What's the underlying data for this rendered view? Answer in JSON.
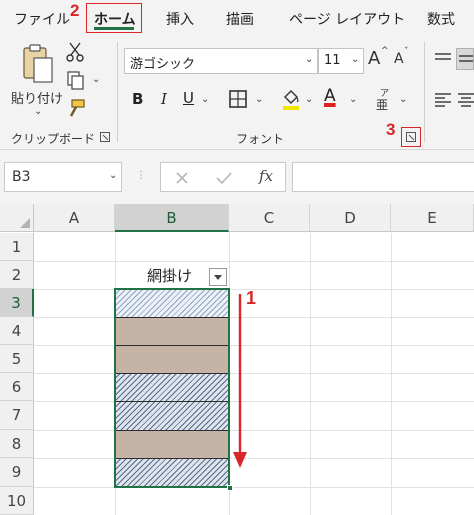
{
  "ribbon_tabs": {
    "file": "ファイル",
    "home": "ホーム",
    "insert": "挿入",
    "draw": "描画",
    "page_layout": "ページ レイアウト",
    "formulas": "数式"
  },
  "clipboard": {
    "paste_label": "貼り付け",
    "group_label": "クリップボード"
  },
  "font": {
    "font_name": "游ゴシック",
    "font_size": "11",
    "group_label": "フォント",
    "bold": "B",
    "italic": "I",
    "underline": "U",
    "font_color_letter": "A",
    "phonetic_top": "ア",
    "phonetic_bottom": "亜",
    "grow": "A",
    "shrink": "A"
  },
  "formula_bar": {
    "name_box": "B3",
    "fx": "fx"
  },
  "sheet": {
    "columns": [
      "A",
      "B",
      "C",
      "D",
      "E"
    ],
    "rows": [
      "1",
      "2",
      "3",
      "4",
      "5",
      "6",
      "7",
      "8",
      "9",
      "10"
    ],
    "b2_value": "網掛け",
    "selected_cell": "B3"
  },
  "annotations": {
    "step1": "1",
    "step2": "2",
    "step3": "3"
  },
  "colors": {
    "excel_green": "#217346",
    "annotation_red": "#d9262b",
    "brown_fill": "#c5b3a5",
    "hatch_pattern": "#5a6a86"
  },
  "icons": [
    "paste-icon",
    "cut-icon",
    "copy-icon",
    "format-painter-icon",
    "border-icon",
    "fill-color-icon",
    "font-color-icon",
    "align-top-icon",
    "align-left-icon",
    "dialog-launcher-icon",
    "cancel-icon",
    "enter-icon",
    "arrow-down-icon"
  ]
}
